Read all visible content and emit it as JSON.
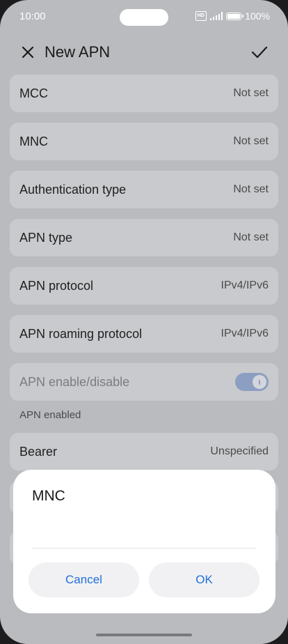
{
  "status_bar": {
    "time": "10:00",
    "hd": "HD",
    "battery": "100%"
  },
  "header": {
    "title": "New APN",
    "close_icon": "close-icon",
    "confirm_icon": "check-icon"
  },
  "settings": [
    {
      "label": "MCC",
      "value": "Not set"
    },
    {
      "label": "MNC",
      "value": "Not set"
    },
    {
      "label": "Authentication type",
      "value": "Not set"
    },
    {
      "label": "APN type",
      "value": "Not set"
    },
    {
      "label": "APN protocol",
      "value": "IPv4/IPv6"
    },
    {
      "label": "APN roaming protocol",
      "value": "IPv4/IPv6"
    }
  ],
  "apn_toggle": {
    "label": "APN enable/disable",
    "caption": "APN enabled",
    "enabled": true
  },
  "bearer": {
    "label": "Bearer",
    "value": "Unspecified"
  },
  "dialog": {
    "title": "MNC",
    "input_value": "",
    "cancel_label": "Cancel",
    "ok_label": "OK"
  },
  "colors": {
    "accent": "#1f6fdc",
    "toggle_on": "#8c9ec2"
  }
}
